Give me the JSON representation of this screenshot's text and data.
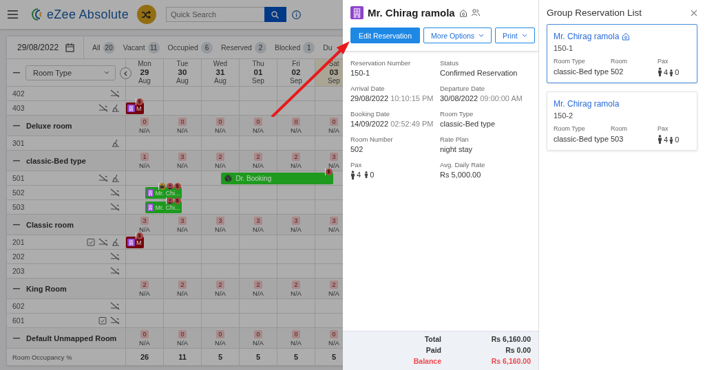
{
  "header": {
    "app_name": "eZee Absolute",
    "search": {
      "placeholder": "Quick Search"
    }
  },
  "toolbar": {
    "date": "29/08/2022",
    "filters": [
      {
        "label": "All",
        "count": "20"
      },
      {
        "label": "Vacant",
        "count": "11"
      },
      {
        "label": "Occupied",
        "count": "6"
      },
      {
        "label": "Reserved",
        "count": "2"
      },
      {
        "label": "Blocked",
        "count": "1"
      },
      {
        "label": "Du"
      }
    ]
  },
  "grid": {
    "room_type_select": "Room Type",
    "days": [
      {
        "weekday": "Mon",
        "date": "29",
        "month": "Aug",
        "highlighted": false
      },
      {
        "weekday": "Tue",
        "date": "30",
        "month": "Aug",
        "highlighted": false
      },
      {
        "weekday": "Wed",
        "date": "31",
        "month": "Aug",
        "highlighted": false
      },
      {
        "weekday": "Thu",
        "date": "01",
        "month": "Sep",
        "highlighted": false
      },
      {
        "weekday": "Fri",
        "date": "02",
        "month": "Sep",
        "highlighted": false
      },
      {
        "weekday": "Sat",
        "date": "03",
        "month": "Sep",
        "highlighted": true
      }
    ],
    "top_rooms": [
      {
        "number": "402",
        "no_smoking": true
      },
      {
        "number": "403",
        "no_smoking": true,
        "cleaning": true,
        "booking": {
          "kind": "reservation",
          "label": "M",
          "color": "#76000c",
          "badges": [
            {
              "kind": "dollar",
              "text": "$"
            }
          ]
        }
      }
    ],
    "groups": [
      {
        "name": "Deluxe room",
        "cells": [
          {
            "count": "0",
            "rate": "N/A"
          },
          {
            "count": "0",
            "rate": "N/A"
          },
          {
            "count": "0",
            "rate": "N/A"
          },
          {
            "count": "0",
            "rate": "N/A"
          },
          {
            "count": "0",
            "rate": "N/A"
          },
          {
            "count": "0",
            "rate": "N/A"
          }
        ],
        "rooms": [
          {
            "number": "301",
            "cleaning": true
          }
        ]
      },
      {
        "name": "classic-Bed type",
        "cells": [
          {
            "count": "1",
            "rate": "N/A"
          },
          {
            "count": "3",
            "rate": "N/A"
          },
          {
            "count": "2",
            "rate": "N/A"
          },
          {
            "count": "2",
            "rate": "N/A"
          },
          {
            "count": "2",
            "rate": "N/A"
          },
          {
            "count": "3",
            "rate": "N/A"
          }
        ],
        "rooms": [
          {
            "number": "501",
            "no_smoking": true,
            "cleaning": true,
            "booking": {
              "kind": "ota",
              "label": "Dr. Booking",
              "color": "#1e9a1e",
              "badges": [
                {
                  "kind": "dollar",
                  "text": "$"
                }
              ]
            }
          },
          {
            "number": "502",
            "no_smoking": true,
            "booking": {
              "kind": "reservation",
              "label": "Mr. Chi...",
              "color": "#1e9a1e",
              "badges": [
                {
                  "kind": "crown"
                },
                {
                  "kind": "guest"
                },
                {
                  "kind": "dollar",
                  "text": "$"
                }
              ]
            }
          },
          {
            "number": "503",
            "no_smoking": true,
            "booking": {
              "kind": "reservation",
              "label": "Mr. Chi...",
              "color": "#1e9a1e",
              "badges": [
                {
                  "kind": "guest"
                },
                {
                  "kind": "dollar",
                  "text": "$"
                }
              ]
            }
          }
        ]
      },
      {
        "name": "Classic room",
        "cells": [
          {
            "count": "3",
            "rate": "N/A"
          },
          {
            "count": "3",
            "rate": "N/A"
          },
          {
            "count": "3",
            "rate": "N/A"
          },
          {
            "count": "3",
            "rate": "N/A"
          },
          {
            "count": "3",
            "rate": "N/A"
          },
          {
            "count": "3",
            "rate": "N/A"
          }
        ],
        "rooms": [
          {
            "number": "201",
            "checklist": true,
            "no_smoking": true,
            "cleaning": true,
            "booking": {
              "kind": "reservation",
              "label": "M",
              "color": "#76000c",
              "badges": [
                {
                  "kind": "dollar",
                  "text": "$"
                }
              ]
            }
          },
          {
            "number": "202",
            "no_smoking": true
          },
          {
            "number": "203",
            "no_smoking": true
          }
        ]
      },
      {
        "name": "King Room",
        "cells": [
          {
            "count": "2",
            "rate": "N/A"
          },
          {
            "count": "2",
            "rate": "N/A"
          },
          {
            "count": "2",
            "rate": "N/A"
          },
          {
            "count": "2",
            "rate": "N/A"
          },
          {
            "count": "2",
            "rate": "N/A"
          },
          {
            "count": "2",
            "rate": "N/A"
          }
        ],
        "rooms": [
          {
            "number": "602",
            "no_smoking": true
          },
          {
            "number": "601",
            "checklist": true,
            "no_smoking": true
          }
        ]
      },
      {
        "name": "Default Unmapped Room",
        "cells": [
          {
            "count": "0",
            "rate": "N/A"
          },
          {
            "count": "0",
            "rate": "N/A"
          },
          {
            "count": "0",
            "rate": "N/A"
          },
          {
            "count": "0",
            "rate": "N/A"
          },
          {
            "count": "0",
            "rate": "N/A"
          },
          {
            "count": "0",
            "rate": "N/A"
          }
        ]
      }
    ],
    "occupancy": {
      "label": "Room Occupancy %",
      "values": [
        "26",
        "11",
        "5",
        "5",
        "5",
        "5"
      ]
    }
  },
  "reservation": {
    "guest_name": "Mr. Chirag ramola",
    "vip": true,
    "group": true,
    "actions": [
      {
        "label": "Edit Reservation",
        "kind": "primary"
      },
      {
        "label": "More Options",
        "kind": "dropdown"
      },
      {
        "label": "Print",
        "kind": "dropdown"
      }
    ],
    "fields": [
      {
        "label": "Reservation Number",
        "value": "150-1"
      },
      {
        "label": "Status",
        "value": "Confirmed Reservation"
      },
      {
        "label": "Arrival Date",
        "value": "29/08/2022",
        "time": "10:10:15 PM"
      },
      {
        "label": "Departure Date",
        "value": "30/08/2022",
        "time": "09:00:00 AM"
      },
      {
        "label": "Booking Date",
        "value": "14/09/2022",
        "time": "02:52:49 PM"
      },
      {
        "label": "Room Type",
        "value": "classic-Bed type"
      },
      {
        "label": "Room Number",
        "value": "502"
      },
      {
        "label": "Rate Plan",
        "value": "night stay"
      },
      {
        "label": "Pax",
        "kind": "pax",
        "adults": "4",
        "children": "0"
      },
      {
        "label": "Avg. Daily Rate",
        "value": "Rs 5,000.00"
      }
    ],
    "totals": [
      {
        "label": "Total",
        "amount": "Rs 6,160.00",
        "kind": "normal"
      },
      {
        "label": "Paid",
        "amount": "Rs 0.00",
        "kind": "normal"
      },
      {
        "label": "Balance",
        "amount": "Rs 6,160.00",
        "kind": "due"
      }
    ]
  },
  "group_list": {
    "title": "Group Reservation List",
    "items": [
      {
        "name": "Mr. Chirag ramola",
        "vip": true,
        "number": "150-1",
        "room_type_label": "Room Type",
        "room_type": "classic-Bed type",
        "room_label": "Room",
        "room": "502",
        "pax_label": "Pax",
        "adults": "4",
        "children": "0",
        "selected": true
      },
      {
        "name": "Mr. Chirag ramola",
        "vip": false,
        "number": "150-2",
        "room_type_label": "Room Type",
        "room_type": "classic-Bed type",
        "room_label": "Room",
        "room": "503",
        "pax_label": "Pax",
        "adults": "4",
        "children": "0",
        "selected": false
      }
    ]
  }
}
